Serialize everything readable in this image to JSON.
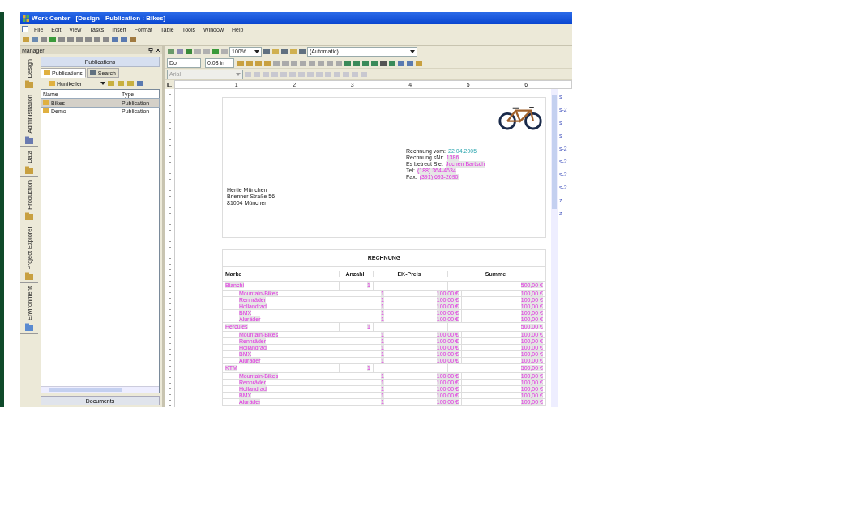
{
  "window": {
    "title": "Work Center - [Design - Publication : Bikes]"
  },
  "menu": [
    "File",
    "Edit",
    "View",
    "Tasks",
    "Insert",
    "Format",
    "Table",
    "Tools",
    "Window",
    "Help"
  ],
  "manager": {
    "title": "Manager",
    "side_tabs": [
      "Design",
      "Administration",
      "Data",
      "Production",
      "Project Explorer",
      "Environment"
    ],
    "panel_title": "Publications",
    "tabs": [
      {
        "label": "Publications",
        "selected": true
      },
      {
        "label": "Search",
        "selected": false
      }
    ],
    "folder": "Hunikeller",
    "columns": [
      "Name",
      "Type"
    ],
    "rows": [
      {
        "name": "Bikes",
        "type": "Publication",
        "selected": true
      },
      {
        "name": "Demo",
        "type": "Publication",
        "selected": false
      }
    ],
    "footer_button": "Documents"
  },
  "editor": {
    "zoom": "100%",
    "style": "(Automatic)",
    "frame_field": "Do",
    "measure": "0.08 in",
    "font": {
      "value": "Arial",
      "disabled": true
    },
    "ruler_labels": [
      "1",
      "2",
      "3",
      "4",
      "5",
      "6"
    ],
    "margin_marks": [
      "s",
      "s-2",
      "s",
      "s",
      "s-2",
      "s-2",
      "s-2",
      "s-2",
      "z",
      "z"
    ]
  },
  "document": {
    "recipient": [
      "Hertie München",
      "Brienner Straße 56",
      "81004 München"
    ],
    "info": [
      {
        "label": "Rechnung vom:",
        "value": "22.04.2005",
        "kind": "date"
      },
      {
        "label": "Rechnung sNr:",
        "value": "1386",
        "kind": "field"
      },
      {
        "label": "Es betreut Sie:",
        "value": "Jochen Bartsch",
        "kind": "field"
      },
      {
        "label": "Tel:",
        "value": "(188) 364-4634",
        "kind": "field"
      },
      {
        "label": "Fax:",
        "value": "(391) 693-2690",
        "kind": "field"
      }
    ],
    "invoice": {
      "title": "RECHNUNG",
      "columns": [
        "Marke",
        "Anzahl",
        "EK-Preis",
        "Summe"
      ],
      "groups": [
        {
          "brand": "Bianchi",
          "qty": "1",
          "sum": "500,00 €",
          "children": [
            {
              "name": "Mountain-Bikes",
              "qty": "1",
              "price": "100,00 €",
              "sum": "100,00 €"
            },
            {
              "name": "Rennräder",
              "qty": "1",
              "price": "100,00 €",
              "sum": "100,00 €"
            },
            {
              "name": "Hollandrad",
              "qty": "1",
              "price": "100,00 €",
              "sum": "100,00 €"
            },
            {
              "name": "BMX",
              "qty": "1",
              "price": "100,00 €",
              "sum": "100,00 €"
            },
            {
              "name": "Aluräder",
              "qty": "1",
              "price": "100,00 €",
              "sum": "100,00 €"
            }
          ]
        },
        {
          "brand": "Hercules",
          "qty": "1",
          "sum": "500,00 €",
          "children": [
            {
              "name": "Mountain-Bikes",
              "qty": "1",
              "price": "100,00 €",
              "sum": "100,00 €"
            },
            {
              "name": "Rennräder",
              "qty": "1",
              "price": "100,00 €",
              "sum": "100,00 €"
            },
            {
              "name": "Hollandrad",
              "qty": "1",
              "price": "100,00 €",
              "sum": "100,00 €"
            },
            {
              "name": "BMX",
              "qty": "1",
              "price": "100,00 €",
              "sum": "100,00 €"
            },
            {
              "name": "Aluräder",
              "qty": "1",
              "price": "100,00 €",
              "sum": "100,00 €"
            }
          ]
        },
        {
          "brand": "KTM",
          "qty": "1",
          "sum": "500,00 €",
          "children": [
            {
              "name": "Mountain-Bikes",
              "qty": "1",
              "price": "100,00 €",
              "sum": "100,00 €"
            },
            {
              "name": "Rennräder",
              "qty": "1",
              "price": "100,00 €",
              "sum": "100,00 €"
            },
            {
              "name": "Hollandrad",
              "qty": "1",
              "price": "100,00 €",
              "sum": "100,00 €"
            },
            {
              "name": "BMX",
              "qty": "1",
              "price": "100,00 €",
              "sum": "100,00 €"
            },
            {
              "name": "Aluräder",
              "qty": "1",
              "price": "100,00 €",
              "sum": "100,00 €"
            }
          ]
        }
      ]
    }
  }
}
